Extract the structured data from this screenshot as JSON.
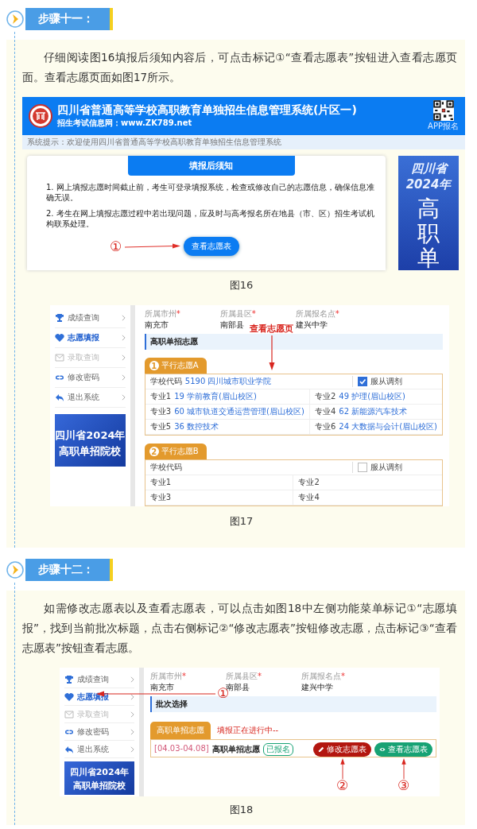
{
  "sections": [
    {
      "step": "步骤十一：",
      "paragraph": "仔细阅读图16填报后须知内容后，可点击标记①“查看志愿表”按钮进入查看志愿页面。查看志愿页面如图17所示。",
      "figures": [
        {
          "kind": "notice_page",
          "caption": "图16",
          "header": {
            "title": "四川省普通高等学校高职教育单独招生信息管理系统(片区一)",
            "subtitle": "招生考试信息网：www.ZK789.net",
            "qr_label": "APP报名"
          },
          "system_tip": "系统提示：欢迎使用四川省普通高等学校高职教育单独招生信息管理系统",
          "notice_title": "填报后须知",
          "notice_items": [
            "1. 网上填报志愿时间截止前，考生可登录填报系统，检查或修改自己的志愿信息，确保信息准确无误。",
            "2. 考生在网上填报志愿过程中若出现问题，应及时与高考报名所在地县（市、区）招生考试机构联系处理。"
          ],
          "marker": "①",
          "button": "查看志愿表",
          "banner": [
            "四川省",
            "2024年",
            "高职单"
          ]
        },
        {
          "kind": "volunteer_page",
          "caption": "图17",
          "sidebar": {
            "items": [
              {
                "label": "成绩查询",
                "selected": false,
                "disabled": false
              },
              {
                "label": "志愿填报",
                "selected": true,
                "disabled": false
              },
              {
                "label": "录取查询",
                "selected": false,
                "disabled": true
              },
              {
                "label": "修改密码",
                "selected": false,
                "disabled": false
              },
              {
                "label": "退出系统",
                "selected": false,
                "disabled": false
              }
            ],
            "banner": [
              "四川省2024年",
              "高职单招院校"
            ]
          },
          "fields": [
            {
              "label": "所属市州",
              "required": "*",
              "value": "南充市"
            },
            {
              "label": "所属县区",
              "required": "*",
              "value": "南部县"
            },
            {
              "label": "所属报名点",
              "required": "*",
              "value": "建兴中学"
            }
          ],
          "section_title": "高职单招志愿",
          "annotation": "查看志愿页",
          "groups": [
            {
              "number": "1",
              "title": "平行志愿A",
              "school_label": "学校代码",
              "school": "5190 四川城市职业学院",
              "adjust_label": "服从调剂",
              "adjust": true,
              "majors": [
                {
                  "label": "专业1",
                  "value": "19 学前教育(眉山校区)"
                },
                {
                  "label": "专业2",
                  "value": "49 护理(眉山校区)"
                },
                {
                  "label": "专业3",
                  "value": "60 城市轨道交通运营管理(眉山校区)"
                },
                {
                  "label": "专业4",
                  "value": "62 新能源汽车技术"
                },
                {
                  "label": "专业5",
                  "value": "36 数控技术"
                },
                {
                  "label": "专业6",
                  "value": "24 大数据与会计(眉山校区)"
                }
              ]
            },
            {
              "number": "2",
              "title": "平行志愿B",
              "school_label": "学校代码",
              "adjust_label": "服从调剂",
              "adjust": false,
              "majors": [
                {
                  "label": "专业1"
                },
                {
                  "label": "专业2"
                },
                {
                  "label": "专业3"
                },
                {
                  "label": "专业4"
                }
              ]
            }
          ]
        }
      ]
    },
    {
      "step": "步骤十二：",
      "paragraph": "如需修改志愿表以及查看志愿表，可以点击如图18中左侧功能菜单标记①“志愿填报”，找到当前批次标题，点击右侧标记②“修改志愿表”按钮修改志愿，点击标记③“查看志愿表”按钮查看志愿。",
      "figures": [
        {
          "kind": "batch_page",
          "caption": "图18",
          "sidebar": {
            "items": [
              {
                "label": "成绩查询",
                "selected": false,
                "disabled": false
              },
              {
                "label": "志愿填报",
                "selected": true,
                "disabled": false
              },
              {
                "label": "录取查询",
                "selected": false,
                "disabled": true
              },
              {
                "label": "修改密码",
                "selected": false,
                "disabled": false
              },
              {
                "label": "退出系统",
                "selected": false,
                "disabled": false
              }
            ],
            "banner": [
              "四川省2024年",
              "高职单招院校"
            ]
          },
          "fields": [
            {
              "label": "所属市州",
              "required": "*",
              "value": "南充市"
            },
            {
              "label": "所属县区",
              "required": "*",
              "value": "南部县"
            },
            {
              "label": "所属报名点",
              "required": "*",
              "value": "建兴中学"
            }
          ],
          "menu_marker": "①",
          "section_title": "批次选择",
          "tab": "高职单招志愿",
          "tab_status": "填报正在进行中--",
          "batch": {
            "date": "[04.03-04.08]",
            "name": "高职单招志愿",
            "badge": "已报名"
          },
          "buttons": [
            {
              "label": "修改志愿表",
              "kind": "edit",
              "marker": "②"
            },
            {
              "label": "查看志愿表",
              "kind": "view",
              "marker": "③"
            }
          ]
        }
      ]
    }
  ]
}
